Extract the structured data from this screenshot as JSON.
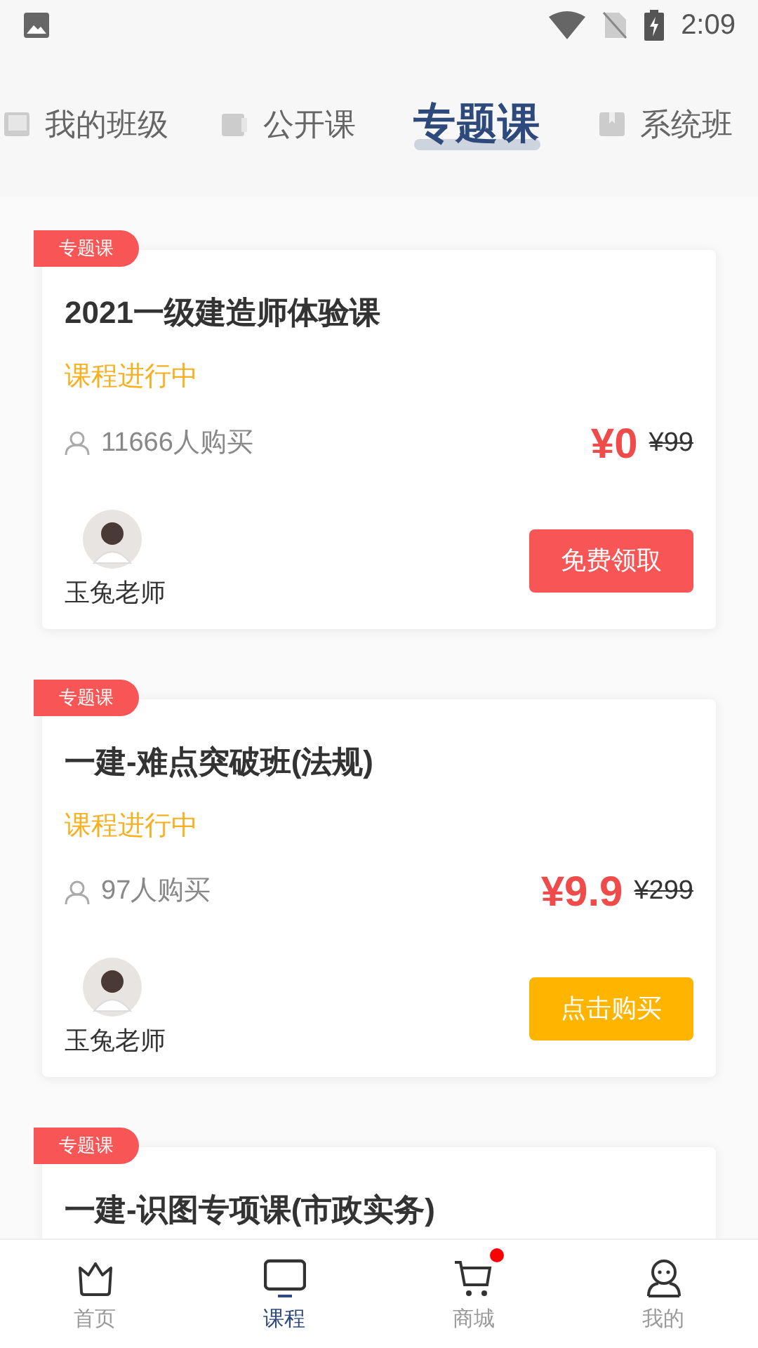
{
  "status_bar": {
    "time": "2:09"
  },
  "tabs": [
    {
      "label": "我的班级",
      "selected": false
    },
    {
      "label": "公开课",
      "selected": false
    },
    {
      "label": "专题课",
      "selected": true
    },
    {
      "label": "系统班",
      "selected": false
    }
  ],
  "courses": [
    {
      "tag": "专题课",
      "title": "2021一级建造师体验课",
      "status": "课程进行中",
      "buyers": "11666人购买",
      "price": "¥0",
      "original_price": "¥99",
      "teacher": "玉兔老师",
      "action": {
        "label": "免费领取",
        "kind": "free"
      }
    },
    {
      "tag": "专题课",
      "title": "一建-难点突破班(法规)",
      "status": "课程进行中",
      "buyers": "97人购买",
      "price": "¥9.9",
      "original_price": "¥299",
      "teacher": "玉兔老师",
      "action": {
        "label": "点击购买",
        "kind": "buy"
      }
    },
    {
      "tag": "专题课",
      "title": "一建-识图专项课(市政实务)"
    }
  ],
  "bottom_nav": [
    {
      "label": "首页",
      "kind": "home",
      "selected": false,
      "badge": false
    },
    {
      "label": "课程",
      "kind": "courses",
      "selected": true,
      "badge": false
    },
    {
      "label": "商城",
      "kind": "shop",
      "selected": false,
      "badge": true
    },
    {
      "label": "我的",
      "kind": "profile",
      "selected": false,
      "badge": false
    }
  ]
}
